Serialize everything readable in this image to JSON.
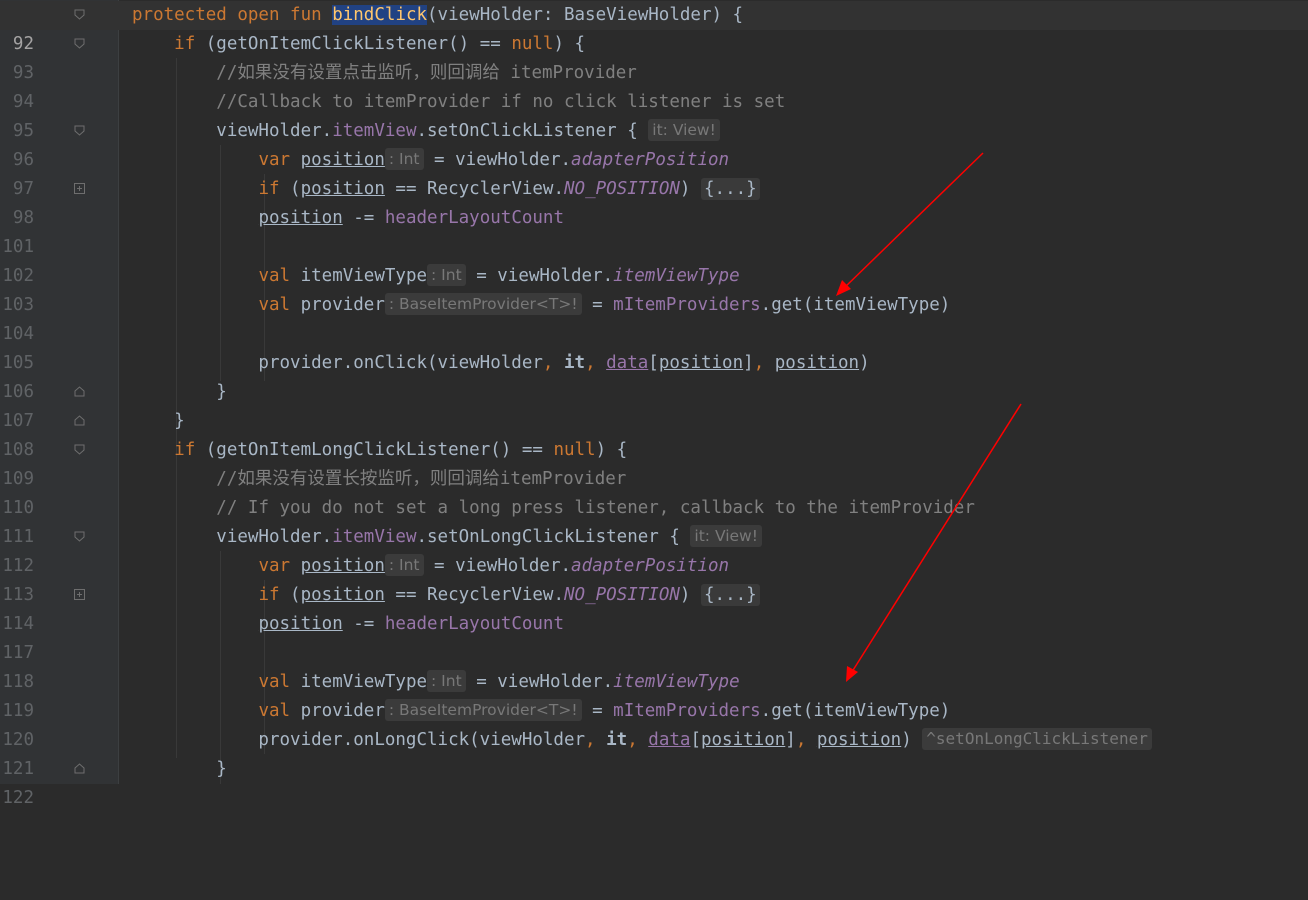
{
  "editor": {
    "selected_word": "bindClick",
    "lines": [
      {
        "num": "92"
      },
      {
        "num": "93"
      },
      {
        "num": "94"
      },
      {
        "num": "95"
      },
      {
        "num": "96"
      },
      {
        "num": "97"
      },
      {
        "num": "98"
      },
      {
        "num": "101"
      },
      {
        "num": "102"
      },
      {
        "num": "103"
      },
      {
        "num": "104"
      },
      {
        "num": "105"
      },
      {
        "num": "106"
      },
      {
        "num": "107"
      },
      {
        "num": "108"
      },
      {
        "num": "109"
      },
      {
        "num": "110"
      },
      {
        "num": "111"
      },
      {
        "num": "112"
      },
      {
        "num": "113"
      },
      {
        "num": "114"
      },
      {
        "num": "117"
      },
      {
        "num": "118"
      },
      {
        "num": "119"
      },
      {
        "num": "120"
      },
      {
        "num": "121"
      },
      {
        "num": "122"
      }
    ],
    "comments": {
      "l94": "//如果没有设置点击监听，则回调给 itemProvider",
      "l95": "//Callback to itemProvider if no click listener is set",
      "l110": "//如果没有设置长按监听，则回调给itemProvider",
      "l111": "// If you do not set a long press listener, callback to the itemProvider"
    },
    "hints": {
      "it_view": "it: View!",
      "int": ": Int",
      "provider_type": ": BaseItemProvider<T>!",
      "folded": "{...}",
      "lambda_label": "^setOnLongClickListener"
    }
  },
  "colors": {
    "background": "#2b2b2b",
    "keyword": "#cc7832",
    "function": "#ffc66d",
    "comment": "#808080",
    "field": "#9876aa",
    "text": "#a9b7c6",
    "annotation_arrow": "#ff0000"
  }
}
